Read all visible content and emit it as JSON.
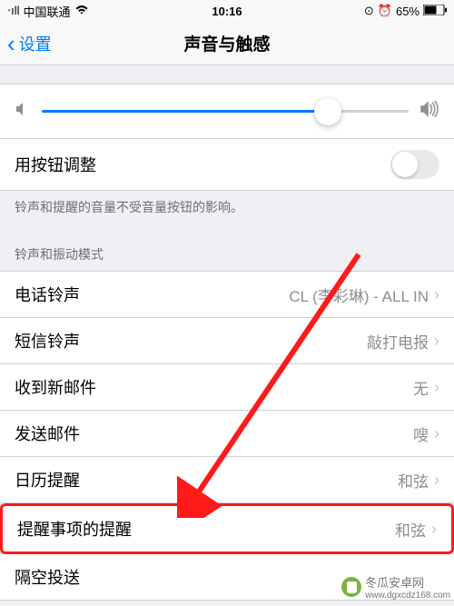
{
  "status": {
    "signal": "⋅ıll",
    "carrier": "中国联通",
    "wifi": "wifi-icon",
    "time": "10:16",
    "orientation": "⊙",
    "alarm": "⏰",
    "battery": "65%",
    "battery_icon": "battery-icon"
  },
  "nav": {
    "back": "设置",
    "title": "声音与触感"
  },
  "volume": {
    "percent": 78
  },
  "button_adjust": {
    "label": "用按钮调整",
    "footer": "铃声和提醒的音量不受音量按钮的影响。"
  },
  "section_header": "铃声和振动模式",
  "rows": [
    {
      "label": "电话铃声",
      "value": "CL (李彩琳) - ALL IN"
    },
    {
      "label": "短信铃声",
      "value": "敲打电报"
    },
    {
      "label": "收到新邮件",
      "value": "无"
    },
    {
      "label": "发送邮件",
      "value": "嗖"
    },
    {
      "label": "日历提醒",
      "value": "和弦"
    },
    {
      "label": "提醒事项的提醒",
      "value": "和弦"
    },
    {
      "label": "隔空投送",
      "value": ""
    }
  ],
  "watermark": {
    "text": "冬瓜安卓网",
    "url": "www.dgxcdz168.com"
  }
}
